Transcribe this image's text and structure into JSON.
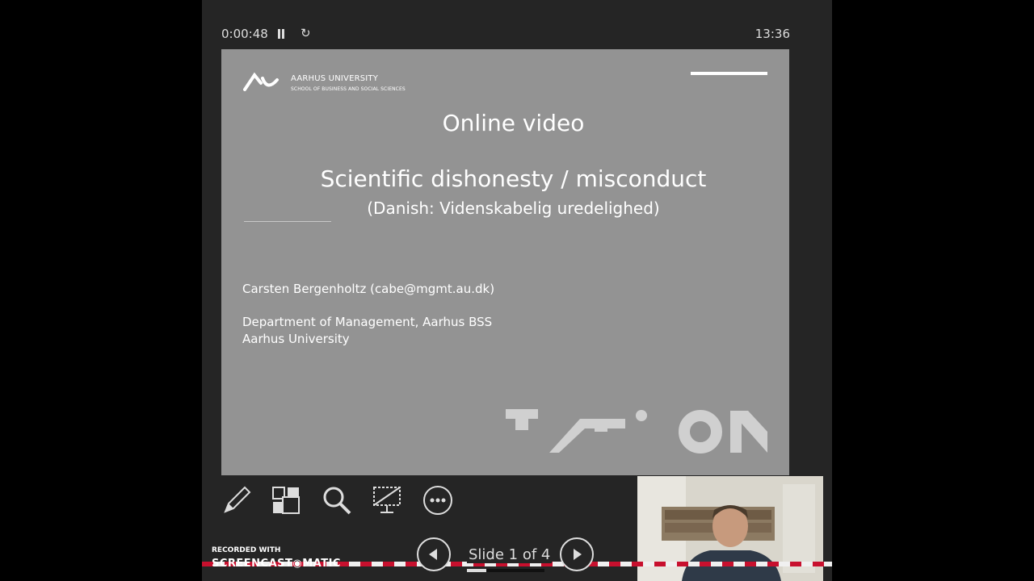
{
  "presenter": {
    "elapsed_time": "0:00:48",
    "clock": "13:36"
  },
  "slide": {
    "university_name": "AARHUS UNIVERSITY",
    "school_name": "SCHOOL OF BUSINESS AND SOCIAL SCIENCES",
    "title": "Online video",
    "subtitle": "Scientific dishonesty / misconduct",
    "subtitle_translation": "(Danish: Videnskabelig uredelighed)",
    "author": "Carsten Bergenholtz (cabe@mgmt.au.dk)",
    "department": "Department of Management, Aarhus BSS",
    "university": "Aarhus University"
  },
  "toolbar": {
    "tools": [
      "pen-tool",
      "slide-overview",
      "zoom",
      "screen-toggle",
      "more-options"
    ]
  },
  "navigation": {
    "slide_counter": "Slide 1 of 4",
    "progress_fraction": 0.25
  },
  "watermark": {
    "recorded_with": "RECORDED WITH",
    "brand": "SCREENCAST◉MATIC"
  },
  "colors": {
    "slide_background": "#939393",
    "presenter_background": "#252525",
    "stripe_red": "#c8102e"
  }
}
